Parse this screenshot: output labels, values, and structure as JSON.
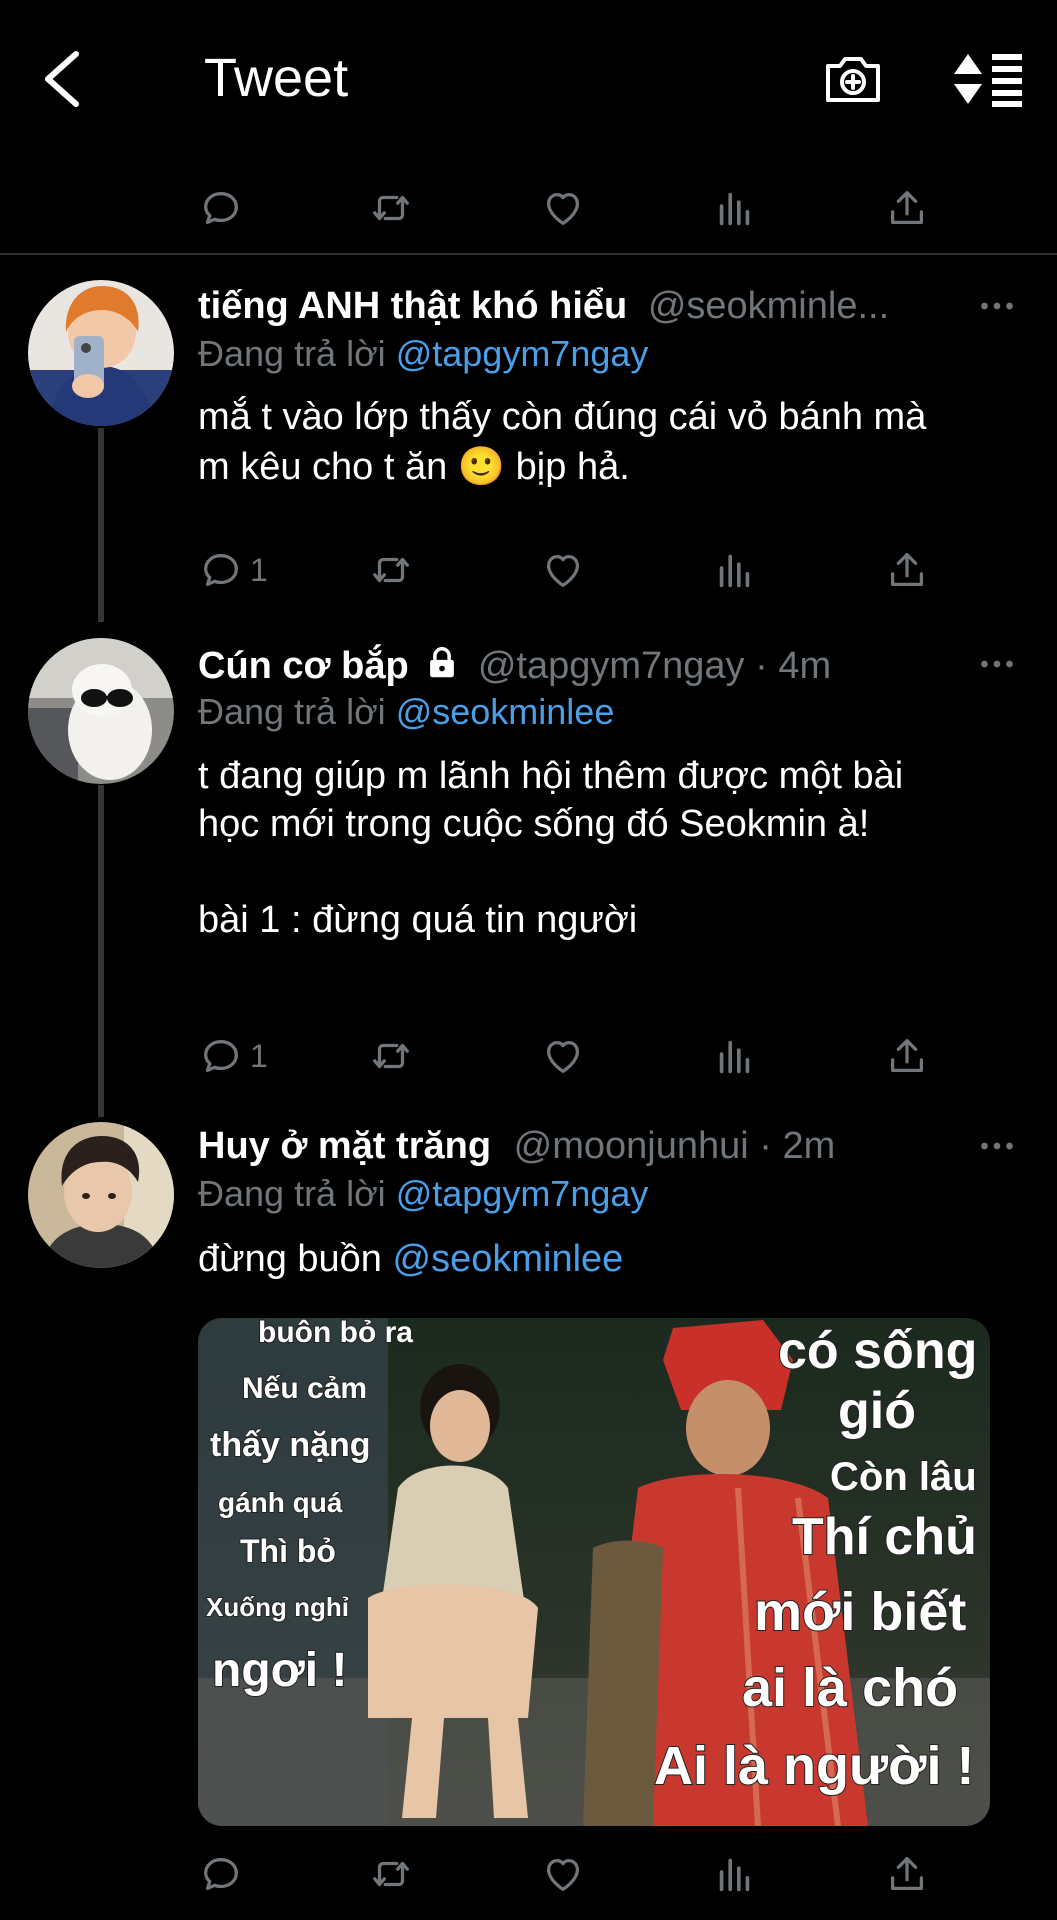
{
  "header": {
    "title": "Tweet"
  },
  "tweets": [
    {
      "display_name": "tiếng ANH thật khó hiểu",
      "handle": "@seokminle...",
      "replying_prefix": "Đang trả lời",
      "replying_to": "@tapgym7ngay",
      "text": "mắ t vào lớp thấy còn đúng cái vỏ bánh mà\nm kêu cho t ăn 🙂 bịp hả.",
      "reply_count": "1"
    },
    {
      "display_name": "Cún cơ bắp",
      "handle": "@tapgym7ngay · 4m",
      "replying_prefix": "Đang trả lời",
      "replying_to": "@seokminlee",
      "text": "t đang giúp m lãnh hội thêm được một bài\nhọc mới trong cuộc sống đó Seokmin à!\n\nbài 1 : đừng quá tin người",
      "reply_count": "1"
    },
    {
      "display_name": "Huy ở mặt trăng",
      "handle": "@moonjunhui · 2m",
      "replying_prefix": "Đang trả lời",
      "replying_to": "@tapgym7ngay",
      "text": "đừng buồn ",
      "text_mention": "@seokminlee",
      "media_text_left": [
        "buôn bỏ ra",
        "Nếu cảm",
        "thấy nặng",
        "gánh quá",
        "Thì bỏ",
        "Xuống nghỉ",
        "ngơi !"
      ],
      "media_text_right": [
        "có sống",
        "gió",
        "Còn lâu",
        "Thí chủ",
        "mới biết",
        "ai là chó",
        "Ai là người !"
      ]
    }
  ],
  "icons": {
    "back": "chevron-left-icon",
    "camera": "camera-plus-icon",
    "sort": "sort-icon",
    "reply": "comment-icon",
    "retweet": "retweet-icon",
    "like": "heart-icon",
    "views": "bar-chart-icon",
    "share": "share-icon",
    "lock": "lock-icon",
    "more": "more-dots-icon"
  },
  "colors": {
    "background": "#000000",
    "text": "#e7e9ea",
    "secondary": "#71767b",
    "link": "#4a9fe8",
    "divider": "#2f3336"
  }
}
